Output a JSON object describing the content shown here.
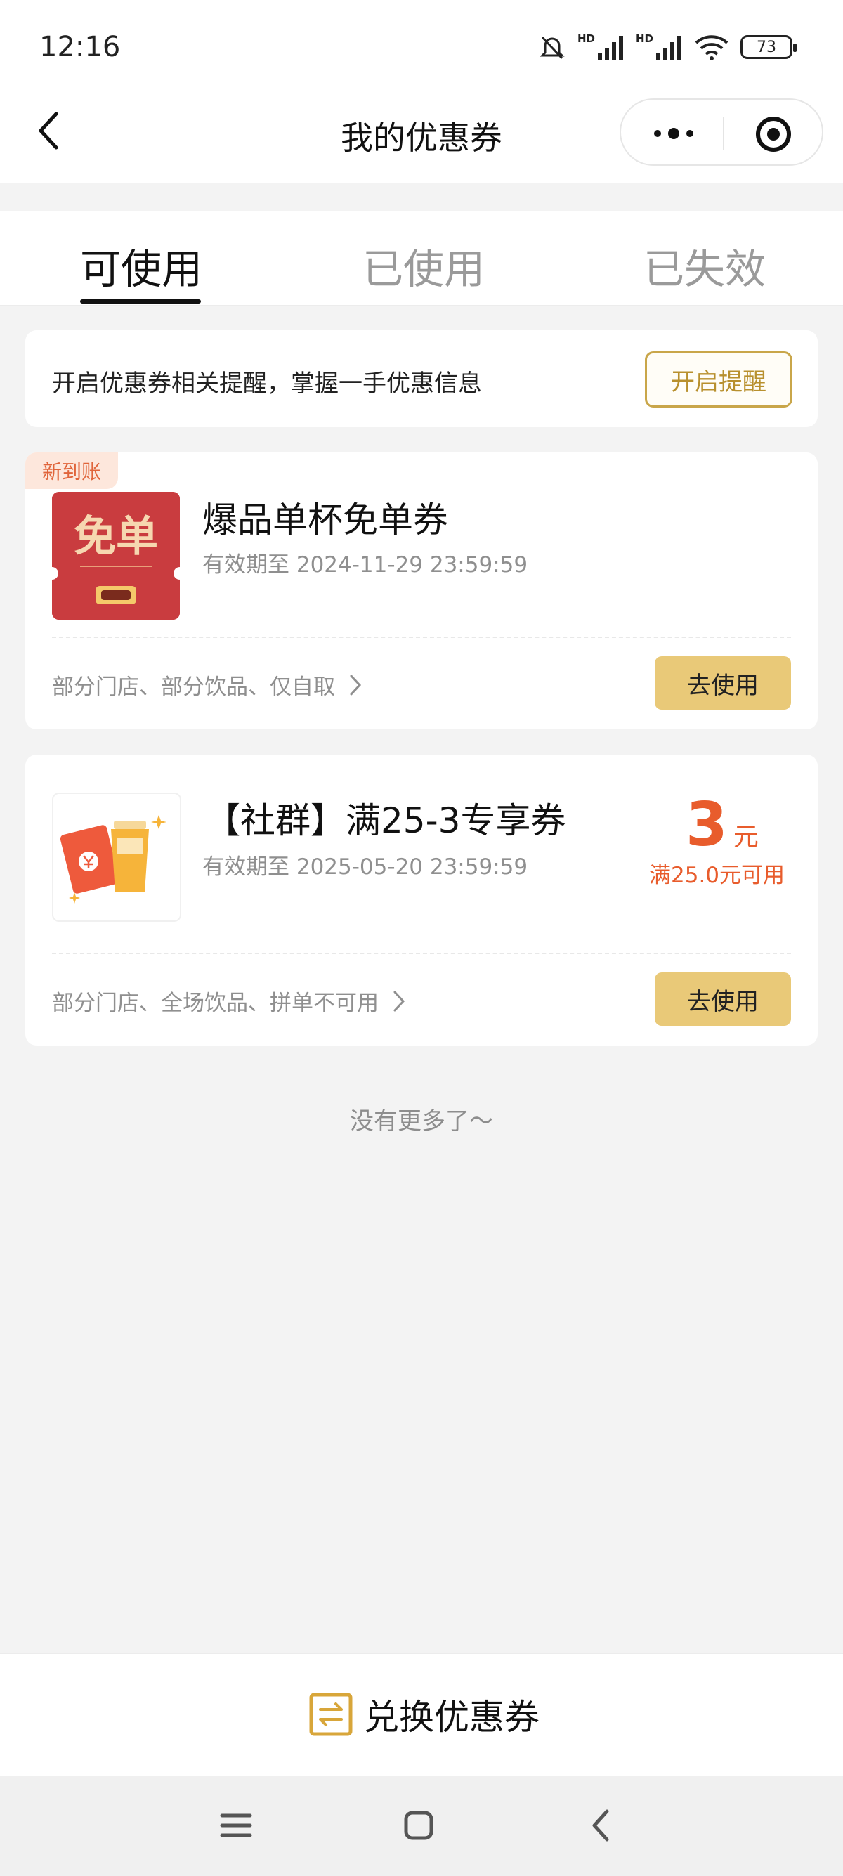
{
  "status_bar": {
    "time": "12:16",
    "hd_1": "HD",
    "hd_2": "HD",
    "battery": "73",
    "icons": [
      "silent-bell-icon",
      "signal-icon",
      "signal-icon",
      "wifi-icon",
      "battery-icon"
    ]
  },
  "header": {
    "title": "我的优惠券"
  },
  "tabs": [
    {
      "label": "可使用",
      "active": true
    },
    {
      "label": "已使用",
      "active": false
    },
    {
      "label": "已失效",
      "active": false
    }
  ],
  "reminder": {
    "text": "开启优惠券相关提醒，掌握一手优惠信息",
    "button": "开启提醒"
  },
  "coupons": [
    {
      "badge": "新到账",
      "thumb_main_text": "免单",
      "title": "爆品单杯免单券",
      "validity": "有效期至 2024-11-29 23:59:59",
      "scope": "部分门店、部分饮品、仅自取",
      "button": "去使用"
    },
    {
      "title": "【社群】满25-3专享券",
      "validity": "有效期至 2025-05-20 23:59:59",
      "amount": "3",
      "amount_unit": "元",
      "condition": "满25.0元可用",
      "scope": "部分门店、全场饮品、拼单不可用",
      "button": "去使用"
    }
  ],
  "no_more": "没有更多了～",
  "bottom": {
    "exchange_label": "兑换优惠券"
  },
  "colors": {
    "accent_gold": "#e9c978",
    "accent_orange": "#e85c2c",
    "coupon_red": "#c93c3f"
  }
}
